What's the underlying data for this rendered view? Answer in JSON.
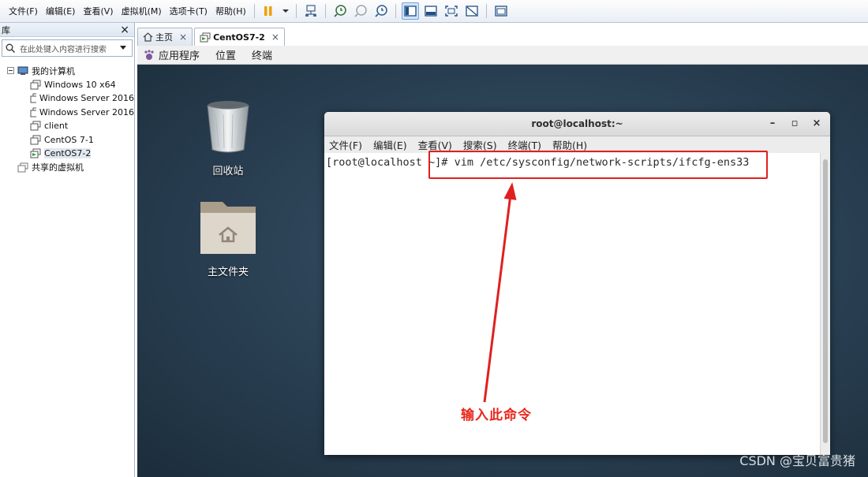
{
  "menubar": {
    "items": [
      "文件(F)",
      "编辑(E)",
      "查看(V)",
      "虚拟机(M)",
      "选项卡(T)",
      "帮助(H)"
    ]
  },
  "library": {
    "title": "库",
    "close": "×",
    "search_placeholder": "在此处键入内容进行搜索",
    "tree": {
      "root": "我的计算机",
      "children": [
        "Windows 10 x64",
        "Windows Server 2016",
        "Windows Server 2016",
        "client",
        "CentOS 7-1",
        "CentOS7-2"
      ],
      "shared": "共享的虚拟机"
    }
  },
  "tabs": [
    {
      "label": "主页",
      "close": "×"
    },
    {
      "label": "CentOS7-2",
      "close": "×"
    }
  ],
  "gnome_bar": {
    "apps": "应用程序",
    "places": "位置",
    "terminal": "终端"
  },
  "desktop": {
    "icons": [
      {
        "label": "回收站",
        "icon": "trash-icon"
      },
      {
        "label": "主文件夹",
        "icon": "home-folder-icon"
      }
    ]
  },
  "terminal": {
    "title": "root@localhost:~",
    "controls": {
      "minimize": "–",
      "maximize": "▫",
      "close": "×"
    },
    "menu": [
      "文件(F)",
      "编辑(E)",
      "查看(V)",
      "搜索(S)",
      "终端(T)",
      "帮助(H)"
    ],
    "prompt": "[root@localhost ~]# ",
    "command": "vim /etc/sysconfig/network-scripts/ifcfg-ens33"
  },
  "annotation": {
    "text": "输入此命令",
    "color": "#e8281c"
  },
  "watermark": "CSDN @宝贝富贵猪"
}
